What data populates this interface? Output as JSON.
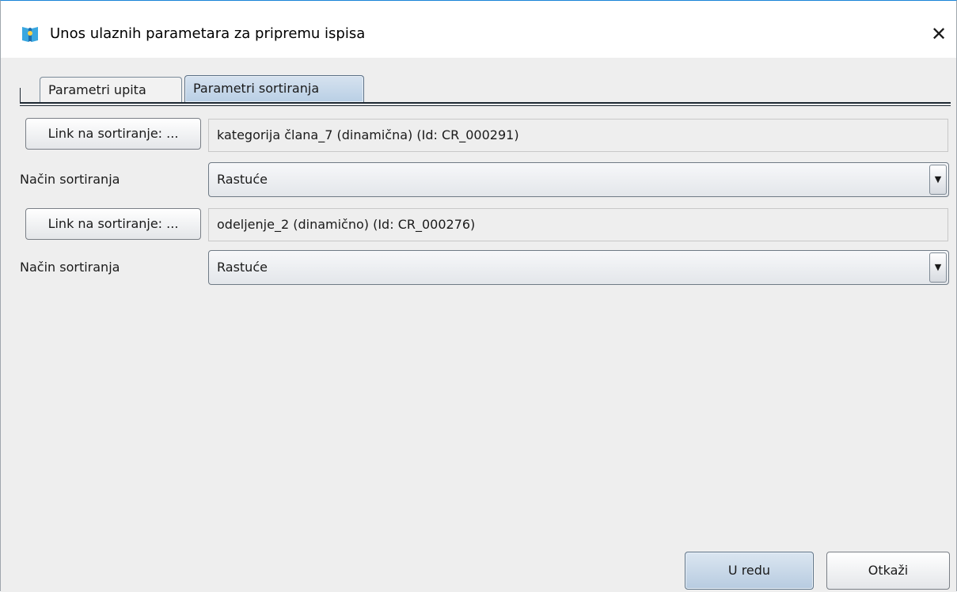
{
  "window": {
    "title": "Unos ulaznih parametara za pripremu ispisa",
    "close_glyph": "✕",
    "app_icon": "library-shield-icon"
  },
  "tabs": [
    {
      "label": "Parametri upita",
      "selected": false
    },
    {
      "label": "Parametri sortiranja",
      "selected": true
    }
  ],
  "sort_rows": [
    {
      "link_button": "Link na sortiranje: ...",
      "link_value": "kategorija člana_7 (dinamična) (Id: CR_000291)",
      "mode_label": "Način sortiranja",
      "mode_value": "Rastuće"
    },
    {
      "link_button": "Link na sortiranje: ...",
      "link_value": "odeljenje_2 (dinamično) (Id: CR_000276)",
      "mode_label": "Način sortiranja",
      "mode_value": "Rastuće"
    }
  ],
  "dropdown_arrow_glyph": "▼",
  "footer": {
    "ok_label": "U redu",
    "cancel_label": "Otkaži"
  },
  "colors": {
    "accent_border": "#1883d7",
    "selected_tab": "#b9cfe5",
    "background": "#eeeeee"
  }
}
